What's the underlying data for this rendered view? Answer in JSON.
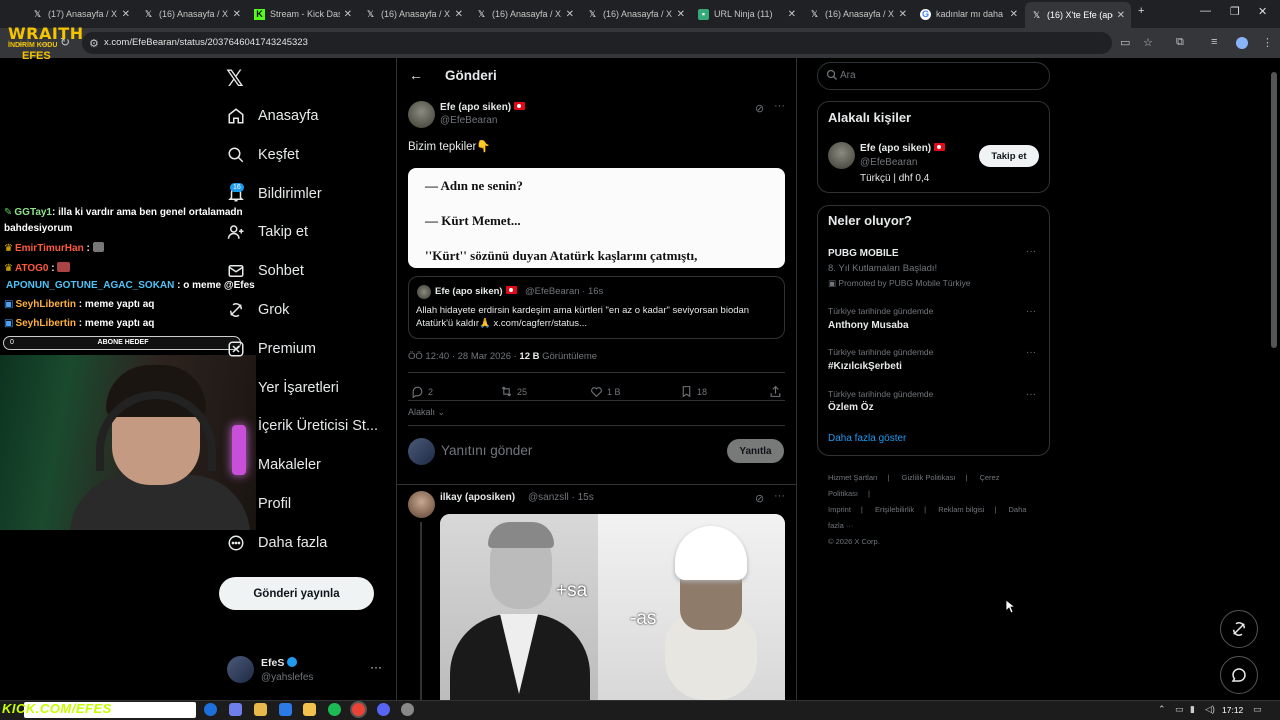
{
  "browser": {
    "tabs": [
      {
        "label": "(17) Anasayfa / X",
        "icon": "x-icon"
      },
      {
        "label": "(16) Anasayfa / X",
        "icon": "x-icon"
      },
      {
        "label": "Stream - Kick Das",
        "icon": "kick-icon"
      },
      {
        "label": "(16) Anasayfa / X",
        "icon": "x-icon"
      },
      {
        "label": "(16) Anasayfa / X",
        "icon": "x-icon"
      },
      {
        "label": "(16) Anasayfa / X",
        "icon": "x-icon"
      },
      {
        "label": "URL Ninja (11)",
        "icon": "url-ninja-icon"
      },
      {
        "label": "(16) Anasayfa / X",
        "icon": "x-icon"
      },
      {
        "label": "kadınlar mı daha",
        "icon": "google-icon"
      },
      {
        "label": "(16) X'te Efe (apo",
        "icon": "x-icon"
      }
    ],
    "url": "x.com/EfeBearan/status/2037646041743245323"
  },
  "overlay": {
    "logo_main": "WRAITH",
    "logo_sub": "İNDİRİM KODU",
    "logo_code": "EFES",
    "chat": [
      {
        "user": "GGTay1",
        "sep": ": ",
        "msg": "illa ki vardır ama ben genel ortalamadn",
        "color": "#8fe38f"
      },
      {
        "user": "",
        "sep": "",
        "msg": "bahdesiyorum",
        "color": "#ffffff"
      },
      {
        "user": "EmirTimurHan",
        "sep": " : ",
        "msg": "",
        "color": "#ff5a3c"
      },
      {
        "user": "ATOG0",
        "sep": " : ",
        "msg": "",
        "color": "#ff5a3c"
      },
      {
        "user": "APONUN_GOTUNE_AGAC_SOKAN",
        "sep": " : ",
        "msg": "o meme @Efes",
        "color": "#4fc3f7"
      },
      {
        "user": "SeyhLibertin",
        "sep": " : ",
        "msg": "meme yaptı aq",
        "color": "#ffb13b"
      },
      {
        "user": "SeyhLibertin",
        "sep": " : ",
        "msg": "meme yaptı aq",
        "color": "#ffb13b"
      }
    ],
    "sub_count": "0",
    "sub_label": "ABONE HEDEF"
  },
  "sidebar": {
    "items": [
      {
        "label": "Anasayfa",
        "icon": "home-icon"
      },
      {
        "label": "Keşfet",
        "icon": "search-icon"
      },
      {
        "label": "Bildirimler",
        "icon": "bell-icon"
      },
      {
        "label": "Takip et",
        "icon": "follow-icon"
      },
      {
        "label": "Sohbet",
        "icon": "mail-icon"
      },
      {
        "label": "Grok",
        "icon": "grok-icon"
      },
      {
        "label": "Premium",
        "icon": "x-premium-icon"
      },
      {
        "label": "Yer İşaretleri",
        "icon": "bookmark-icon"
      },
      {
        "label": "İçerik Üreticisi St...",
        "icon": "creator-studio-icon"
      },
      {
        "label": "Makaleler",
        "icon": "articles-icon"
      },
      {
        "label": "Profil",
        "icon": "profile-icon"
      },
      {
        "label": "Daha fazla",
        "icon": "more-circle-icon"
      }
    ],
    "notif_count": "16",
    "post_button": "Gönderi yayınla",
    "account": {
      "name": "EfeS",
      "handle": "@yahslefes"
    }
  },
  "main": {
    "title": "Gönderi",
    "tweet": {
      "name": "Efe (apo siken)",
      "handle": "@EfeBearan",
      "text": "Bizim tepkiler👇",
      "image_lines": [
        "— Adın ne senin?",
        "— Kürt Memet...",
        "''Kürt'' sözünü duyan Atatürk kaşlarını çatmıştı,"
      ],
      "quote": {
        "name": "Efe (apo siken)",
        "handle": "@EfeBearan · 16s",
        "text": "Allah hidayete erdirsin kardeşim ama kürtleri \"en az o kadar\" seviyorsan biodan Atatürk'ü kaldır🙏 x.com/cagferr/status..."
      },
      "meta_time": "ÖÖ 12:40 · 28 Mar 2026 · ",
      "meta_views": "12 B",
      "meta_views_label": " Görüntüleme",
      "actions": {
        "replies": "2",
        "reposts": "25",
        "likes": "1 B",
        "bookmarks": "18"
      },
      "relevant": "Alakalı"
    },
    "reply_box": {
      "placeholder": "Yanıtını gönder",
      "button": "Yanıtla"
    },
    "reply": {
      "name": "ilkay (aposiken)",
      "handle": "@sanzsll · 15s",
      "image_caption_left": "+sa",
      "image_caption_right": "-as"
    }
  },
  "right": {
    "search_placeholder": "Ara",
    "relevant_people": {
      "title": "Alakalı kişiler",
      "name": "Efe (apo siken)",
      "handle": "@EfeBearan",
      "bio": "Türkçü | dhf 0,4",
      "follow": "Takip et"
    },
    "trends": {
      "title": "Neler oluyor?",
      "promoted": {
        "title": "PUBG MOBILE",
        "subtitle": "8. Yıl Kutlamaları Başladı!",
        "promo": "Promoted by PUBG Mobile Türkiye"
      },
      "items": [
        {
          "context": "Türkiye tarihinde gündemde",
          "title": "Anthony Musaba"
        },
        {
          "context": "Türkiye tarihinde gündemde",
          "title": "#KızılcıkŞerbeti"
        },
        {
          "context": "Türkiye tarihinde gündemde",
          "title": "Özlem Öz"
        }
      ],
      "show_more": "Daha fazla göster"
    },
    "footer": [
      "Hizmet Şartları",
      "|",
      "Gizlilik Politikası",
      "|",
      "Çerez Politikası",
      "|",
      "Imprint",
      "|",
      "Erişilebilirlik",
      "|",
      "Reklam bilgisi",
      "|",
      "Daha fazla ···",
      "© 2026 X Corp."
    ]
  },
  "taskbar": {
    "watermark": "KICK.COM/EFES",
    "clock": "17:12"
  }
}
